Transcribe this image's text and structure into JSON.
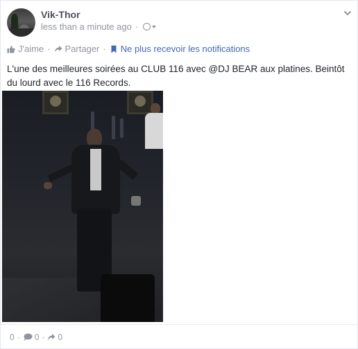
{
  "post": {
    "author": "Vik-Thor",
    "timestamp": "less than a minute ago",
    "privacy_icon": "globe-icon",
    "text": "L'une des meilleures soirées au CLUB 116 avec @DJ BEAR aux platines. Beintôt du lourd avec le 116 Records."
  },
  "actions": {
    "like_label": "J'aime",
    "share_label": "Partager",
    "unfollow_label": "Ne plus recevoir les notifications",
    "separator": "·"
  },
  "footer": {
    "likes_count": "0",
    "comments_count": "0",
    "shares_count": "0",
    "separator": "·"
  },
  "colors": {
    "link": "#4267b2",
    "muted": "#90949c",
    "author": "#4b4f56"
  }
}
